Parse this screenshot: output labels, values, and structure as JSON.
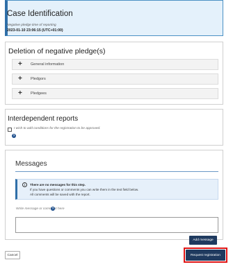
{
  "case": {
    "title": "Case Identification",
    "subtitle": "Negative pledge time of reporting",
    "timestamp": "2023-01-10 23:06:15 (UTC+01:00)"
  },
  "deletion": {
    "title": "Deletion of negative pledge(s)",
    "sections": [
      {
        "label": "General information"
      },
      {
        "label": "Pledgors"
      },
      {
        "label": "Pledgees"
      }
    ]
  },
  "interdependent": {
    "title": "Interdependent reports",
    "checkbox_label": "I wish to add conditions for the registration to be approved.",
    "checked": false
  },
  "messages": {
    "title": "Messages",
    "info_line1": "There are no messages for this step.",
    "info_line2": "If you have questions or comments you can write them in the text field below.",
    "info_line3": "All comments will be saved with the report.",
    "write_label": "Write message or comment here",
    "textarea_value": "",
    "add_button": "Add message"
  },
  "footer": {
    "cancel": "Cancel",
    "request": "Request registration"
  },
  "icons": {
    "accordion": "plus-icon",
    "help": "question-icon",
    "info": "info-icon"
  },
  "colors": {
    "primary": "#1f3a5f",
    "case_bg": "#e4f1fb",
    "highlight": "#e01515"
  }
}
